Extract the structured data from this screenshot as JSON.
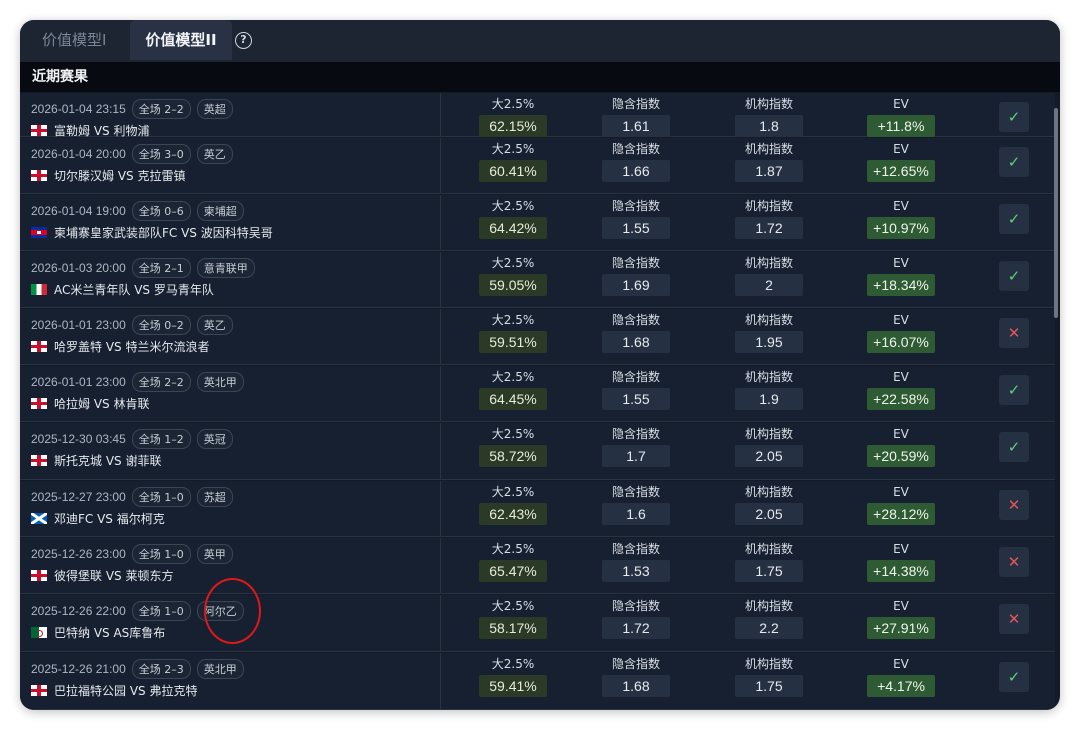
{
  "tabs": [
    {
      "label": "价值模型I",
      "active": false
    },
    {
      "label": "价值模型II",
      "active": true
    }
  ],
  "help_icon": "?",
  "section_title": "近期赛果",
  "labels": {
    "over": "大2.5%",
    "implied": "隐含指数",
    "org": "机构指数",
    "ev": "EV"
  },
  "matches": [
    {
      "time": "2026-01-04 23:15",
      "score": "全场 2–2",
      "league": "英超",
      "flag": "eng",
      "teams": "富勒姆 VS 利物浦",
      "over": "62.15%",
      "implied": "1.61",
      "org": "1.8",
      "ev": "+11.8%",
      "result": "win"
    },
    {
      "time": "2026-01-04 20:00",
      "score": "全场 3–0",
      "league": "英乙",
      "flag": "eng",
      "teams": "切尔滕汉姆 VS 克拉雷镇",
      "over": "60.41%",
      "implied": "1.66",
      "org": "1.87",
      "ev": "+12.65%",
      "result": "win"
    },
    {
      "time": "2026-01-04 19:00",
      "score": "全场 0–6",
      "league": "柬埔超",
      "flag": "kh",
      "teams": "柬埔寨皇家武装部队FC VS 波因科特吴哥",
      "over": "64.42%",
      "implied": "1.55",
      "org": "1.72",
      "ev": "+10.97%",
      "result": "win"
    },
    {
      "time": "2026-01-03 20:00",
      "score": "全场 2–1",
      "league": "意青联甲",
      "flag": "it",
      "teams": "AC米兰青年队 VS 罗马青年队",
      "over": "59.05%",
      "implied": "1.69",
      "org": "2",
      "ev": "+18.34%",
      "result": "win"
    },
    {
      "time": "2026-01-01 23:00",
      "score": "全场 0–2",
      "league": "英乙",
      "flag": "eng",
      "teams": "哈罗盖特 VS 特兰米尔流浪者",
      "over": "59.51%",
      "implied": "1.68",
      "org": "1.95",
      "ev": "+16.07%",
      "result": "loss"
    },
    {
      "time": "2026-01-01 23:00",
      "score": "全场 2–2",
      "league": "英北甲",
      "flag": "eng",
      "teams": "哈拉姆 VS 林肯联",
      "over": "64.45%",
      "implied": "1.55",
      "org": "1.9",
      "ev": "+22.58%",
      "result": "win"
    },
    {
      "time": "2025-12-30 03:45",
      "score": "全场 1–2",
      "league": "英冠",
      "flag": "eng",
      "teams": "斯托克城 VS 谢菲联",
      "over": "58.72%",
      "implied": "1.7",
      "org": "2.05",
      "ev": "+20.59%",
      "result": "win"
    },
    {
      "time": "2025-12-27 23:00",
      "score": "全场 1–0",
      "league": "苏超",
      "flag": "sco",
      "teams": "邓迪FC VS 福尔柯克",
      "over": "62.43%",
      "implied": "1.6",
      "org": "2.05",
      "ev": "+28.12%",
      "result": "loss"
    },
    {
      "time": "2025-12-26 23:00",
      "score": "全场 1–0",
      "league": "英甲",
      "flag": "eng",
      "teams": "彼得堡联 VS 莱顿东方",
      "over": "65.47%",
      "implied": "1.53",
      "org": "1.75",
      "ev": "+14.38%",
      "result": "loss"
    },
    {
      "time": "2025-12-26 22:00",
      "score": "全场 1–0",
      "league": "阿尔乙",
      "flag": "dz",
      "teams": "巴特纳 VS AS库鲁布",
      "over": "58.17%",
      "implied": "1.72",
      "org": "2.2",
      "ev": "+27.91%",
      "result": "loss"
    },
    {
      "time": "2025-12-26 21:00",
      "score": "全场 2–3",
      "league": "英北甲",
      "flag": "eng",
      "teams": "巴拉福特公园 VS 弗拉克特",
      "over": "59.41%",
      "implied": "1.68",
      "org": "1.75",
      "ev": "+4.17%",
      "result": "win"
    }
  ],
  "result_glyphs": {
    "win": "✓",
    "loss": "✕"
  },
  "colors": {
    "win": "#5fcf7a",
    "loss": "#e0575b",
    "ev_bg": "#2e5a34",
    "annotation": "#e01818"
  }
}
